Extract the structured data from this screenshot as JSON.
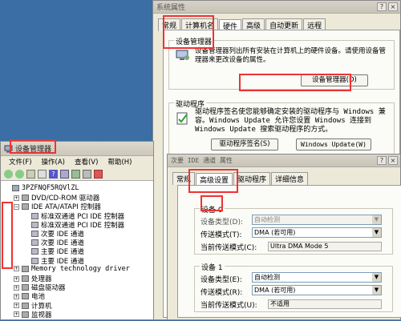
{
  "sysprop": {
    "title": "系统属性",
    "tabs": [
      "常规",
      "计算机名",
      "硬件",
      "高级",
      "自动更新",
      "远程"
    ],
    "devmgr_group": "设备管理器",
    "devmgr_text": "设备管理器列出所有安装在计算机上的硬件设备。请使用设备管理器来更改设备的属性。",
    "devmgr_button": "设备管理器(D)",
    "driver_group": "驱动程序",
    "driver_text": "驱动程序签名使您能够确定安装的驱动程序与 Windows 兼容。Windows Update 允许您设置 Windows 连接到 Windows Update 搜索驱动程序的方式。",
    "driver_sign_button": "驱动程序签名(S)",
    "wu_button": "Windows Update(W)"
  },
  "devmgr": {
    "title": "设备管理器",
    "menu": [
      "文件(F)",
      "操作(A)",
      "查看(V)",
      "帮助(H)"
    ],
    "tree": [
      {
        "label": "3PZFNQF5RQVlZL",
        "indent": 0
      },
      {
        "label": "DVD/CD-ROM 驱动器",
        "indent": 1
      },
      {
        "label": "IDE ATA/ATAPI 控制器",
        "indent": 1
      },
      {
        "label": "标准双通道 PCI IDE 控制器",
        "indent": 2
      },
      {
        "label": "标准双通道 PCI IDE 控制器",
        "indent": 2
      },
      {
        "label": "次要 IDE 通道",
        "indent": 2
      },
      {
        "label": "次要 IDE 通道",
        "indent": 2
      },
      {
        "label": "主要 IDE 通道",
        "indent": 2
      },
      {
        "label": "主要 IDE 通道",
        "indent": 2
      },
      {
        "label": "Memory technology driver",
        "indent": 1
      },
      {
        "label": "处理器",
        "indent": 1
      },
      {
        "label": "磁盘驱动器",
        "indent": 1
      },
      {
        "label": "电池",
        "indent": 1
      },
      {
        "label": "计算机",
        "indent": 1
      },
      {
        "label": "监视器",
        "indent": 1
      }
    ]
  },
  "ideprop": {
    "title": "次要 IDE 通道 属性",
    "tabs": [
      "常规",
      "高级设置",
      "驱动程序",
      "详细信息"
    ],
    "dev0_group": "设备 0",
    "dev0_type_label": "设备类型(D):",
    "dev0_type_value": "自动检测",
    "dev0_mode_label": "传送模式(T):",
    "dev0_mode_value": "DMA (若可用)",
    "dev0_current_label": "当前传送模式(C):",
    "dev0_current_value": "Ultra DMA Mode 5",
    "dev1_group": "设备 1",
    "dev1_type_label": "设备类型(E):",
    "dev1_type_value": "自动检测",
    "dev1_mode_label": "传送模式(R):",
    "dev1_mode_value": "DMA (若可用)",
    "dev1_current_label": "当前传送模式(U):",
    "dev1_current_value": "不适用"
  }
}
